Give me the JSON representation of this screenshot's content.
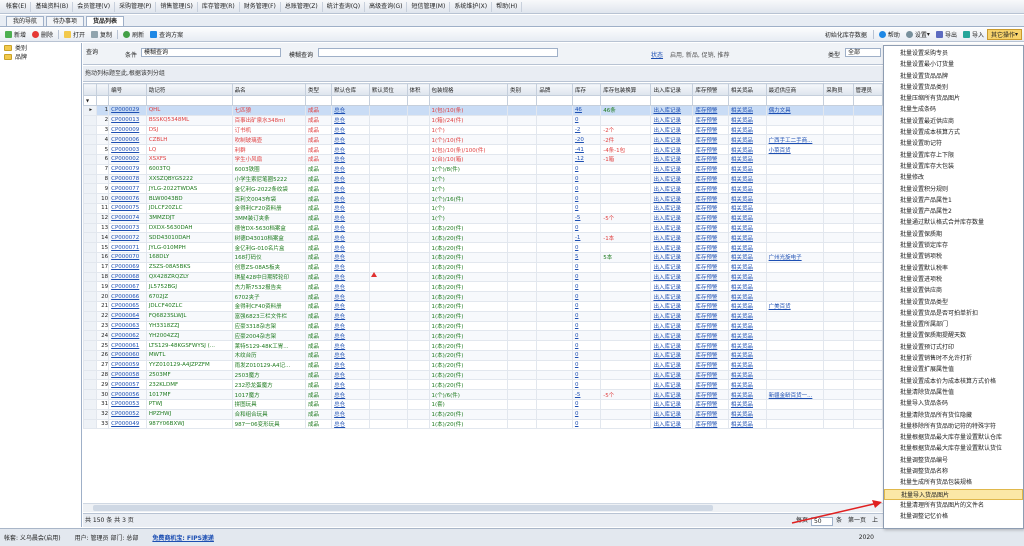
{
  "menubar": [
    "帐套(E)",
    "基础资料(B)",
    "会员管理(V)",
    "采购管理(P)",
    "销售管理(S)",
    "库存管理(R)",
    "财务管理(F)",
    "总账管理(Z)",
    "统计查询(Q)",
    "高级查询(G)",
    "短信管理(M)",
    "系统维护(X)",
    "帮助(H)"
  ],
  "tabs": [
    "我的导航",
    "待办事项",
    "货品列表"
  ],
  "toolbar": {
    "new": "新增",
    "delete": "删除",
    "open": "打开",
    "copy": "复制",
    "refresh": "刷新",
    "query_plan": "查询方案",
    "init_stock": "初始化库存数据",
    "help": "帮助",
    "settings": "设置",
    "export": "导出",
    "import": "导入",
    "other_ops": "其它操作"
  },
  "tree": [
    "类别",
    "品牌"
  ],
  "search": {
    "query_btn": "查询",
    "cond_label": "条件",
    "cond_value": "模糊查询",
    "fuzzy_label": "模糊查询",
    "status_label": "状态",
    "status_value": "启用, 新品, 促销, 推荐",
    "type_label": "类型",
    "type_value": "全部"
  },
  "group_hint": "拖动列标题至此,根据该列分组",
  "columns": [
    "编号",
    "助记符",
    "品名",
    "类型",
    "默认仓库",
    "默认货位",
    "体积",
    "包装规格",
    "类别",
    "品牌",
    "库存",
    "库存包装换算",
    "出入库记录",
    "库存预警",
    "相关货品",
    "最近供应商",
    "采购员",
    "管理员"
  ],
  "rows": [
    {
      "n": "1",
      "code": "CP000029",
      "mn": "QHL",
      "name": "七匹狼",
      "type": "成品",
      "wh": "总仓",
      "spec": "1(包)/10(条)",
      "stock": "46",
      "conv": "46条",
      "in": "出入库记录",
      "warn": "库存预警",
      "rel": "相关货品",
      "sup": "偶力文具",
      "c": "red"
    },
    {
      "n": "2",
      "code": "CP000013",
      "mn": "BSSKQ5348ML",
      "name": "百事出矿泉水348ml",
      "type": "成品",
      "wh": "总仓",
      "spec": "1(箱)/24(件)",
      "stock": "0",
      "conv": "",
      "in": "出入库记录",
      "warn": "库存预警",
      "rel": "相关货品",
      "sup": "",
      "c": "red"
    },
    {
      "n": "3",
      "code": "CP000009",
      "mn": "DSJ",
      "name": "订书机",
      "type": "成品",
      "wh": "总仓",
      "spec": "1(个)",
      "stock": "-2",
      "conv": "-2个",
      "in": "出入库记录",
      "warn": "库存预警",
      "rel": "相关货品",
      "sup": "",
      "c": "red"
    },
    {
      "n": "4",
      "code": "CP000006",
      "mn": "CZBLH",
      "name": "吹制玻璃壶",
      "type": "成品",
      "wh": "总仓",
      "spec": "1(个)/10(件)",
      "stock": "-20",
      "conv": "-2件",
      "in": "出入库记录",
      "warn": "库存预警",
      "rel": "相关货品",
      "sup": "广西手工二手商...",
      "c": "red"
    },
    {
      "n": "5",
      "code": "CP000003",
      "mn": "LQ",
      "name": "利群",
      "type": "成品",
      "wh": "总仓",
      "spec": "1(包)/10(条)/100(件)",
      "stock": "-41",
      "conv": "-4条-1包",
      "in": "出入库记录",
      "warn": "库存预警",
      "rel": "相关货品",
      "sup": "小菜百货",
      "c": "red"
    },
    {
      "n": "6",
      "code": "CP000002",
      "mn": "XSXFS",
      "name": "学生小风扇",
      "type": "成品",
      "wh": "总仓",
      "spec": "1(台)/10(箱)",
      "stock": "-12",
      "conv": "-1箱",
      "in": "出入库记录",
      "warn": "库存预警",
      "rel": "相关货品",
      "sup": "",
      "c": "red"
    },
    {
      "n": "7",
      "code": "CP000079",
      "mn": "6003TQ",
      "name": "6003铁圈",
      "type": "成品",
      "wh": "总仓",
      "spec": "1(个)/8(件)",
      "stock": "0",
      "conv": "",
      "in": "出入库记录",
      "warn": "库存预警",
      "rel": "相关货品",
      "sup": "",
      "c": "green"
    },
    {
      "n": "8",
      "code": "CP000078",
      "mn": "XXSZQBYG5222",
      "name": "小学生索尼笔圈5222",
      "type": "成品",
      "wh": "总仓",
      "spec": "1(个)",
      "stock": "0",
      "conv": "",
      "in": "出入库记录",
      "warn": "库存预警",
      "rel": "相关货品",
      "sup": "",
      "c": "green"
    },
    {
      "n": "9",
      "code": "CP000077",
      "mn": "JYLG-2022TWDAS",
      "name": "金亿利G-2022条纹袋",
      "type": "成品",
      "wh": "总仓",
      "spec": "1(个)",
      "stock": "0",
      "conv": "",
      "in": "出入库记录",
      "warn": "库存预警",
      "rel": "相关货品",
      "sup": "",
      "c": "green"
    },
    {
      "n": "10",
      "code": "CP000076",
      "mn": "BLW0043BD",
      "name": "百利文0043布袋",
      "type": "成品",
      "wh": "总仓",
      "spec": "1(个)/16(件)",
      "stock": "0",
      "conv": "",
      "in": "出入库记录",
      "warn": "库存预警",
      "rel": "相关货品",
      "sup": "",
      "c": "green"
    },
    {
      "n": "11",
      "code": "CP000075",
      "mn": "JDLCF20ZLC",
      "name": "金得利CF20资料册",
      "type": "成品",
      "wh": "总仓",
      "spec": "1(个)",
      "stock": "0",
      "conv": "",
      "in": "出入库记录",
      "warn": "库存预警",
      "rel": "相关货品",
      "sup": "",
      "c": "green"
    },
    {
      "n": "12",
      "code": "CP000074",
      "mn": "3MMZDJT",
      "name": "3MM装订夹条",
      "type": "成品",
      "wh": "总仓",
      "spec": "1(个)",
      "stock": "-5",
      "conv": "-5个",
      "in": "出入库记录",
      "warn": "库存预警",
      "rel": "相关货品",
      "sup": "",
      "c": "green"
    },
    {
      "n": "13",
      "code": "CP000073",
      "mn": "DXDX-5630DAH",
      "name": "德信DX-5630档案盒",
      "type": "成品",
      "wh": "总仓",
      "spec": "1(本)/20(件)",
      "stock": "0",
      "conv": "",
      "in": "出入库记录",
      "warn": "库存预警",
      "rel": "相关货品",
      "sup": "",
      "c": "green"
    },
    {
      "n": "14",
      "code": "CP000072",
      "mn": "SDD43010DAH",
      "name": "树德D43010档案盒",
      "type": "成品",
      "wh": "总仓",
      "spec": "1(本)/20(件)",
      "stock": "-1",
      "conv": "-1本",
      "in": "出入库记录",
      "warn": "库存预警",
      "rel": "相关货品",
      "sup": "",
      "c": "green"
    },
    {
      "n": "15",
      "code": "CP000071",
      "mn": "JYLG-010MPH",
      "name": "金亿利G-010名片盒",
      "type": "成品",
      "wh": "总仓",
      "spec": "1(本)/20(件)",
      "stock": "0",
      "conv": "",
      "in": "出入库记录",
      "warn": "库存预警",
      "rel": "相关货品",
      "sup": "",
      "c": "green"
    },
    {
      "n": "16",
      "code": "CP000070",
      "mn": "168DLY",
      "name": "168打码仪",
      "type": "成品",
      "wh": "总仓",
      "spec": "1(本)/20(件)",
      "stock": "5",
      "conv": "5本",
      "in": "出入库记录",
      "warn": "库存预警",
      "rel": "相关货品",
      "sup": "广州光旋电子",
      "c": "green"
    },
    {
      "n": "17",
      "code": "CP000069",
      "mn": "ZSZS-08A5BKS",
      "name": "创意ZS-08A5板夹",
      "type": "成品",
      "wh": "总仓",
      "spec": "1(本)/20(件)",
      "stock": "0",
      "conv": "",
      "in": "出入库记录",
      "warn": "库存预警",
      "rel": "相关货品",
      "sup": "",
      "c": "green"
    },
    {
      "n": "18",
      "code": "CP000068",
      "mn": "QX428ZRQZLY",
      "name": "琪星428中日期转轮印",
      "type": "成品",
      "wh": "总仓",
      "spec": "1(本)/20(件)",
      "stock": "0",
      "conv": "",
      "in": "出入库记录",
      "warn": "库存预警",
      "rel": "相关货品",
      "sup": "",
      "c": "green"
    },
    {
      "n": "19",
      "code": "CP000067",
      "mn": "JL5752BGJ",
      "name": "杰力斯7532报告夹",
      "type": "成品",
      "wh": "总仓",
      "spec": "1(本)/20(件)",
      "stock": "0",
      "conv": "",
      "in": "出入库记录",
      "warn": "库存预警",
      "rel": "相关货品",
      "sup": "",
      "c": "green"
    },
    {
      "n": "20",
      "code": "CP000066",
      "mn": "6702JZ",
      "name": "6702夹子",
      "type": "成品",
      "wh": "总仓",
      "spec": "1(本)/20(件)",
      "stock": "0",
      "conv": "",
      "in": "出入库记录",
      "warn": "库存预警",
      "rel": "相关货品",
      "sup": "",
      "c": "green"
    },
    {
      "n": "21",
      "code": "CP000065",
      "mn": "JDLCF40ZLC",
      "name": "金得利CF40资料册",
      "type": "成品",
      "wh": "总仓",
      "spec": "1(本)/20(件)",
      "stock": "0",
      "conv": "",
      "in": "出入库记录",
      "warn": "库存预警",
      "rel": "相关货品",
      "sup": "广美百货",
      "c": "green"
    },
    {
      "n": "22",
      "code": "CP000064",
      "mn": "FQ6823SLWJL",
      "name": "富强6823三栏文件栏",
      "type": "成品",
      "wh": "总仓",
      "spec": "1(本)/20(件)",
      "stock": "0",
      "conv": "",
      "in": "出入库记录",
      "warn": "库存预警",
      "rel": "相关货品",
      "sup": "",
      "c": "green"
    },
    {
      "n": "23",
      "code": "CP000063",
      "mn": "YH3318ZZJ",
      "name": "应豪3318杂志架",
      "type": "成品",
      "wh": "总仓",
      "spec": "1(本)/20(件)",
      "stock": "0",
      "conv": "",
      "in": "出入库记录",
      "warn": "库存预警",
      "rel": "相关货品",
      "sup": "",
      "c": "green"
    },
    {
      "n": "24",
      "code": "CP000062",
      "mn": "YH2004ZZJ",
      "name": "应豪2004杂志架",
      "type": "成品",
      "wh": "总仓",
      "spec": "1(本)/20(件)",
      "stock": "0",
      "conv": "",
      "in": "出入库记录",
      "warn": "库存预警",
      "rel": "相关货品",
      "sup": "",
      "c": "green"
    },
    {
      "n": "25",
      "code": "CP000061",
      "mn": "LTS129-48KGSFWYSJ (...",
      "name": "莱特5129-48K工胃...",
      "type": "成品",
      "wh": "总仓",
      "spec": "1(本)/20(件)",
      "stock": "0",
      "conv": "",
      "in": "出入库记录",
      "warn": "库存预警",
      "rel": "相关货品",
      "sup": "",
      "c": "green"
    },
    {
      "n": "26",
      "code": "CP000060",
      "mn": "MWTL",
      "name": "木纹台历",
      "type": "成品",
      "wh": "总仓",
      "spec": "1(本)/20(件)",
      "stock": "0",
      "conv": "",
      "in": "出入库记录",
      "warn": "库存预警",
      "rel": "相关货品",
      "sup": "",
      "c": "green"
    },
    {
      "n": "27",
      "code": "CP000059",
      "mn": "YYZ010129-A4JZPZFM",
      "name": "雨发Z010129-A4记...",
      "type": "成品",
      "wh": "总仓",
      "spec": "1(本)/20(件)",
      "stock": "0",
      "conv": "",
      "in": "出入库记录",
      "warn": "库存预警",
      "rel": "相关货品",
      "sup": "",
      "c": "green"
    },
    {
      "n": "28",
      "code": "CP000058",
      "mn": "2503MF",
      "name": "2503魔方",
      "type": "成品",
      "wh": "总仓",
      "spec": "1(本)/20(件)",
      "stock": "0",
      "conv": "",
      "in": "出入库记录",
      "warn": "库存预警",
      "rel": "相关货品",
      "sup": "",
      "c": "green"
    },
    {
      "n": "29",
      "code": "CP000057",
      "mn": "232KLDMF",
      "name": "232恐龙蛋魔方",
      "type": "成品",
      "wh": "总仓",
      "spec": "1(本)/20(件)",
      "stock": "0",
      "conv": "",
      "in": "出入库记录",
      "warn": "库存预警",
      "rel": "相关货品",
      "sup": "",
      "c": "green"
    },
    {
      "n": "30",
      "code": "CP000056",
      "mn": "1017MF",
      "name": "1017魔方",
      "type": "成品",
      "wh": "总仓",
      "spec": "1(个)/6(件)",
      "stock": "-5",
      "conv": "-5个",
      "in": "出入库记录",
      "warn": "库存预警",
      "rel": "相关货品",
      "sup": "新疆金龄百货一...",
      "c": "green"
    },
    {
      "n": "31",
      "code": "CP000053",
      "mn": "PTWJ",
      "name": "拼图玩具",
      "type": "成品",
      "wh": "总仓",
      "spec": "1(套)",
      "stock": "0",
      "conv": "",
      "in": "出入库记录",
      "warn": "库存预警",
      "rel": "相关货品",
      "sup": "",
      "c": "green"
    },
    {
      "n": "32",
      "code": "CP000052",
      "mn": "HPZHWJ",
      "name": "合和组合玩具",
      "type": "成品",
      "wh": "总仓",
      "spec": "1(本)/20(件)",
      "stock": "0",
      "conv": "",
      "in": "出入库记录",
      "warn": "库存预警",
      "rel": "相关货品",
      "sup": "",
      "c": "green"
    },
    {
      "n": "33",
      "code": "CP000049",
      "mn": "987Y06BXWJ",
      "name": "987一06变形玩具",
      "type": "成品",
      "wh": "总仓",
      "spec": "1(本)/20(件)",
      "stock": "0",
      "conv": "",
      "in": "出入库记录",
      "warn": "库存预警",
      "rel": "相关货品",
      "sup": "",
      "c": "green"
    }
  ],
  "footer": {
    "total": "共 150 条  共 3 页",
    "per_page_label": "每页",
    "per_page": "50",
    "per_page_unit": "条",
    "first": "第一页",
    "prev": "上"
  },
  "status": {
    "company": "帐套: 义乌晨会(启用)",
    "user": "用户: 管理员  部门: 总部",
    "link": "免费商机宝: FIPS速递",
    "date": "2020"
  },
  "context_menu": [
    "批量设置采购专员",
    "批量设置最小订货量",
    "批量设置货品品牌",
    "批量设置货品类别",
    "批量压缩所有货品图片",
    "批量生成条码",
    "批量设置最近供应商",
    "批量设置成本核算方式",
    "批量设置助记符",
    "批量设置库存上下限",
    "批量设置库存大包装",
    "批量修改",
    "批量设置积分规则",
    "批量设置产品属性1",
    "批量设置产品属性2",
    "批量通过默认格式合并库存数量",
    "批量设置保质期",
    "批量设置锁定库存",
    "批量设置销项税",
    "批量设置默认税率",
    "批量设置进项税",
    "批量设置供应商",
    "批量设置货品类型",
    "批量设置货品是否可拍单折扣",
    "批量设置所属部门",
    "批量设置保质期提醒天数",
    "批量设置预订式打印",
    "批量设置销售时不允许打折",
    "批量设置扩展属性值",
    "批量设置成本价为成本核算方式价格",
    "批量清除货品属性值",
    "批量导入货品条码",
    "批量清除货品所有货位隐藏",
    "批量移除所有货品助记符的特殊字符",
    "批量根据货品最大库存量设置默认仓库",
    "批量根据货品最大库存量设置默认货位",
    "批量调整货品编号",
    "批量调整货品名称",
    "批量生成所有货品包装规格",
    "批量导入货品图片",
    "批量清理所有货品图片的文件名",
    "批量调整记忆价格"
  ],
  "highlighted_menu_index": 39,
  "colors": {
    "red_text": "#e04040",
    "green_text": "#1e7a1e",
    "selected_row": "#c9dcf5",
    "menu_highlight": "#fbe8a6"
  }
}
